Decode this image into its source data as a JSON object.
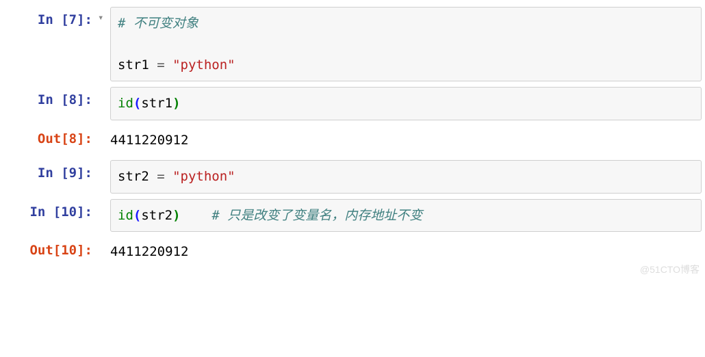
{
  "cells": [
    {
      "in_prompt": "In [7]:",
      "arrow": "▾",
      "code": {
        "line1_comment": "# 不可变对象",
        "line3_var": "str1",
        "line3_op": " = ",
        "line3_str": "\"python\""
      }
    },
    {
      "in_prompt": "In [8]:",
      "code": {
        "func": "id",
        "arg": "str1"
      },
      "out_prompt": "Out[8]:",
      "output": "4411220912"
    },
    {
      "in_prompt": "In [9]:",
      "code": {
        "var": "str2",
        "op": " = ",
        "str": "\"python\""
      }
    },
    {
      "in_prompt": "In [10]:",
      "code": {
        "func": "id",
        "arg": "str2",
        "comment": "# 只是改变了变量名，内存地址不变"
      },
      "out_prompt": "Out[10]:",
      "output": "4411220912"
    }
  ],
  "watermark": "@51CTO博客"
}
